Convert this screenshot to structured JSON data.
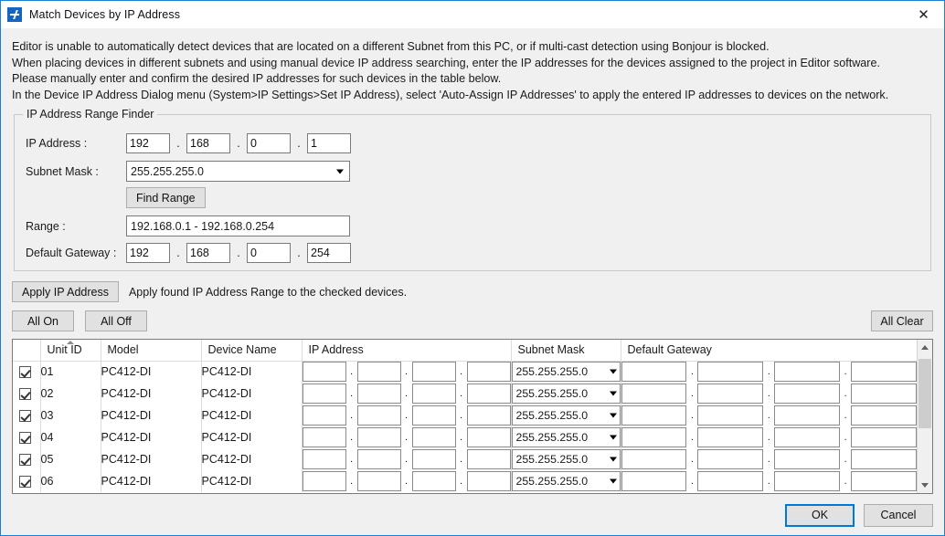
{
  "window": {
    "title": "Match Devices by IP Address",
    "icon": "network-device-icon",
    "close_label": "✕"
  },
  "description": [
    "Editor is unable to automatically detect devices that are located on a different Subnet from this PC, or if multi-cast detection using Bonjour is blocked.",
    "When placing devices in different subnets and using manual device IP address searching, enter the IP addresses for the devices assigned to the project in Editor software.",
    "Please manually enter and confirm the desired  IP addresses for such devices in the table below.",
    "In the Device IP Address Dialog menu (System>IP Settings>Set IP Address), select 'Auto-Assign IP Addresses' to apply the entered IP addresses to devices on the network."
  ],
  "range_finder": {
    "legend": "IP Address Range Finder",
    "ip_address": {
      "label": "IP Address :",
      "octets": [
        "192",
        "168",
        "0",
        "1"
      ],
      "separator": "."
    },
    "subnet_mask": {
      "label": "Subnet Mask :",
      "value": "255.255.255.0"
    },
    "find_range_button": "Find Range",
    "range": {
      "label": "Range :",
      "value": "192.168.0.1 - 192.168.0.254"
    },
    "default_gateway": {
      "label": "Default Gateway :",
      "octets": [
        "192",
        "168",
        "0",
        "254"
      ],
      "separator": "."
    }
  },
  "apply": {
    "button": "Apply IP Address",
    "note": "Apply found IP Address Range to the checked devices."
  },
  "toggles": {
    "all_on": "All On",
    "all_off": "All Off",
    "all_clear": "All Clear"
  },
  "table": {
    "columns": [
      "",
      "Unit ID",
      "Model",
      "Device Name",
      "IP Address",
      "Subnet Mask",
      "Default Gateway"
    ],
    "sorted_column": "Unit ID",
    "rows": [
      {
        "checked": true,
        "unit_id": "01",
        "model": "PC412-DI",
        "device_name": "PC412-DI",
        "ip": [
          "",
          "",
          "",
          ""
        ],
        "subnet_mask": "255.255.255.0",
        "gateway": [
          "",
          "",
          "",
          ""
        ]
      },
      {
        "checked": true,
        "unit_id": "02",
        "model": "PC412-DI",
        "device_name": "PC412-DI",
        "ip": [
          "",
          "",
          "",
          ""
        ],
        "subnet_mask": "255.255.255.0",
        "gateway": [
          "",
          "",
          "",
          ""
        ]
      },
      {
        "checked": true,
        "unit_id": "03",
        "model": "PC412-DI",
        "device_name": "PC412-DI",
        "ip": [
          "",
          "",
          "",
          ""
        ],
        "subnet_mask": "255.255.255.0",
        "gateway": [
          "",
          "",
          "",
          ""
        ]
      },
      {
        "checked": true,
        "unit_id": "04",
        "model": "PC412-DI",
        "device_name": "PC412-DI",
        "ip": [
          "",
          "",
          "",
          ""
        ],
        "subnet_mask": "255.255.255.0",
        "gateway": [
          "",
          "",
          "",
          ""
        ]
      },
      {
        "checked": true,
        "unit_id": "05",
        "model": "PC412-DI",
        "device_name": "PC412-DI",
        "ip": [
          "",
          "",
          "",
          ""
        ],
        "subnet_mask": "255.255.255.0",
        "gateway": [
          "",
          "",
          "",
          ""
        ]
      },
      {
        "checked": true,
        "unit_id": "06",
        "model": "PC412-DI",
        "device_name": "PC412-DI",
        "ip": [
          "",
          "",
          "",
          ""
        ],
        "subnet_mask": "255.255.255.0",
        "gateway": [
          "",
          "",
          "",
          ""
        ]
      }
    ],
    "separator": "."
  },
  "footer": {
    "ok": "OK",
    "cancel": "Cancel"
  },
  "colors": {
    "window_border": "#1d7fd4",
    "dialog_bg": "#f0f0f0",
    "focus_border": "#0078d7",
    "icon_blue": "#1565c0"
  }
}
